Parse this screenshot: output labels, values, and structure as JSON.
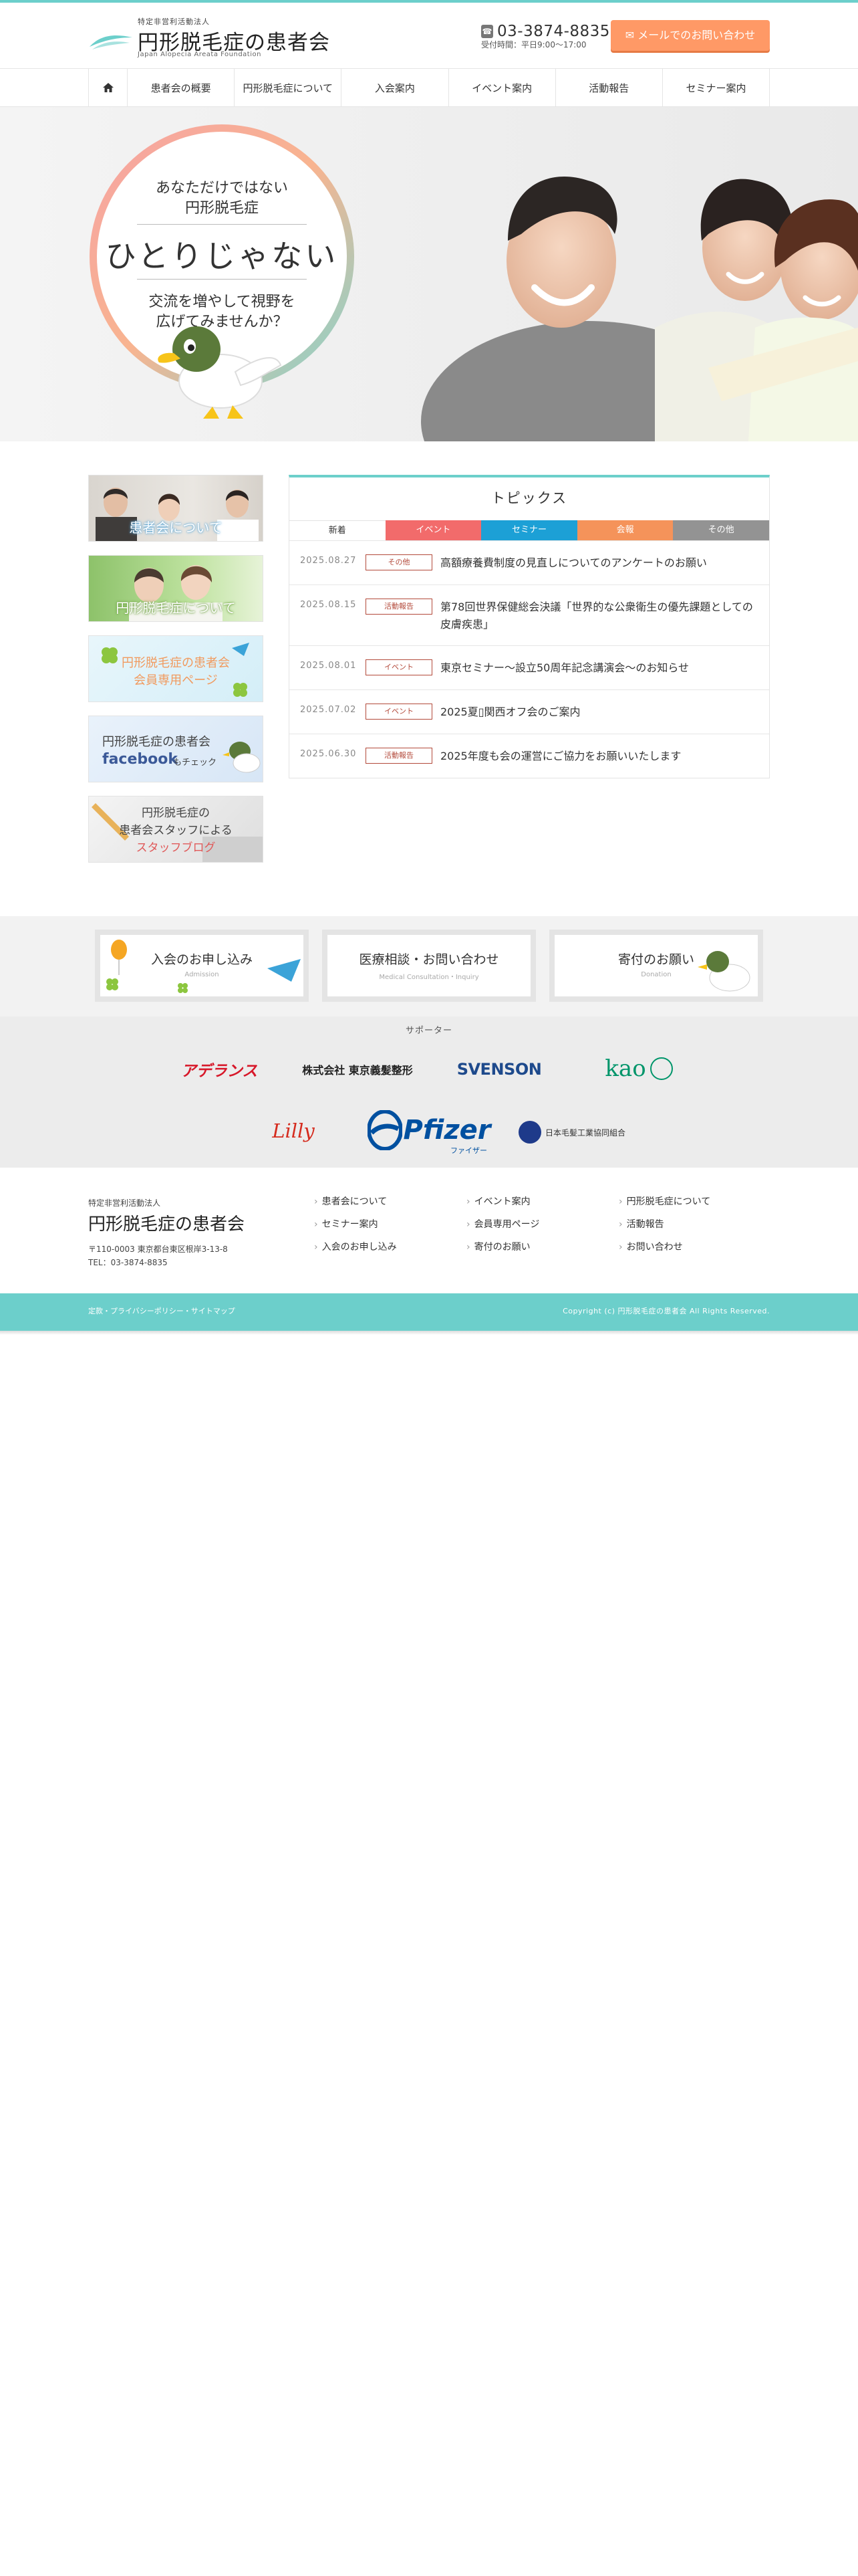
{
  "header": {
    "logo_sub": "特定非営利活動法人",
    "logo_main": "円形脱毛症の患者会",
    "logo_en": "Japan Alopecia Areata Foundation",
    "tel_number": "03-3874-8835",
    "tel_hours": "受付時間：平日9:00〜17:00",
    "mail_button": "メールでのお問い合わせ"
  },
  "nav": {
    "home_icon": "home-icon",
    "items": [
      "患者会の概要",
      "円形脱毛症について",
      "入会案内",
      "イベント案内",
      "活動報告",
      "セミナー案内"
    ]
  },
  "hero": {
    "line1": "あなただけではない",
    "line2": "円形脱毛症",
    "big": "ひとりじゃない",
    "line3": "交流を増やして視野を",
    "line4": "広げてみませんか？"
  },
  "side_banners": [
    {
      "label": "患者会について",
      "color": "#ffffff"
    },
    {
      "label": "円形脱毛症について",
      "color": "#ffffff"
    },
    {
      "label": "円形脱毛症の患者会",
      "label2": "会員専用ページ",
      "color": "#f19a5e"
    },
    {
      "label": "円形脱毛症の患者会",
      "label2": "facebook",
      "label3": "もチェック",
      "color": "#444444"
    },
    {
      "label": "円形脱毛症の",
      "label2": "患者会スタッフによる",
      "label3": "スタッフブログ",
      "color": "#444444"
    }
  ],
  "topics": {
    "title": "トピックス",
    "tabs": [
      {
        "label": "新着",
        "color": "#ffffff"
      },
      {
        "label": "イベント",
        "color": "#f26b6b"
      },
      {
        "label": "セミナー",
        "color": "#1ca0d6"
      },
      {
        "label": "会報",
        "color": "#f5935a"
      },
      {
        "label": "その他",
        "color": "#939393"
      }
    ],
    "news": [
      {
        "date": "2025.08.27",
        "tag": "その他",
        "title": "高額療養費制度の見直しについてのアンケートのお願い"
      },
      {
        "date": "2025.08.15",
        "tag": "活動報告",
        "title": "第78回世界保健総会決議「世界的な公衆衛生の優先課題としての皮膚疾患」"
      },
      {
        "date": "2025.08.01",
        "tag": "イベント",
        "title": "東京セミナー〜設立50周年記念講演会〜のお知らせ"
      },
      {
        "date": "2025.07.02",
        "tag": "イベント",
        "title": "2025夏▯関西オフ会のご案内"
      },
      {
        "date": "2025.06.30",
        "tag": "活動報告",
        "title": "2025年度も会の運営にご協力をお願いいたします"
      }
    ]
  },
  "cta": [
    {
      "title": "入会のお申し込み",
      "en": "Admission"
    },
    {
      "title": "医療相談・お問い合わせ",
      "en": "Medical Consultation・Inquiry"
    },
    {
      "title": "寄付のお願い",
      "en": "Donation"
    }
  ],
  "supporters": {
    "label": "サポーター",
    "logos": [
      "アデランス",
      "株式会社 東京義髪整形",
      "SVENSON",
      "kao",
      "Lilly",
      "Pfizer",
      "ファイザー",
      "日本毛髪工業協同組合"
    ]
  },
  "footer": {
    "org_sub": "特定非営利活動法人",
    "org_name": "円形脱毛症の患者会",
    "address": "〒110-0003 東京都台東区根岸3-13-8",
    "tel": "TEL：03-3874-8835",
    "links": [
      "患者会について",
      "イベント案内",
      "円形脱毛症について",
      "セミナー案内",
      "会員専用ページ",
      "活動報告",
      "入会のお申し込み",
      "寄付のお願い",
      "お問い合わせ"
    ],
    "bottom_left": "定款・プライバシーポリシー・サイトマップ",
    "copyright": "Copyright (c) 円形脱毛症の患者会 All Rights Reserved."
  }
}
